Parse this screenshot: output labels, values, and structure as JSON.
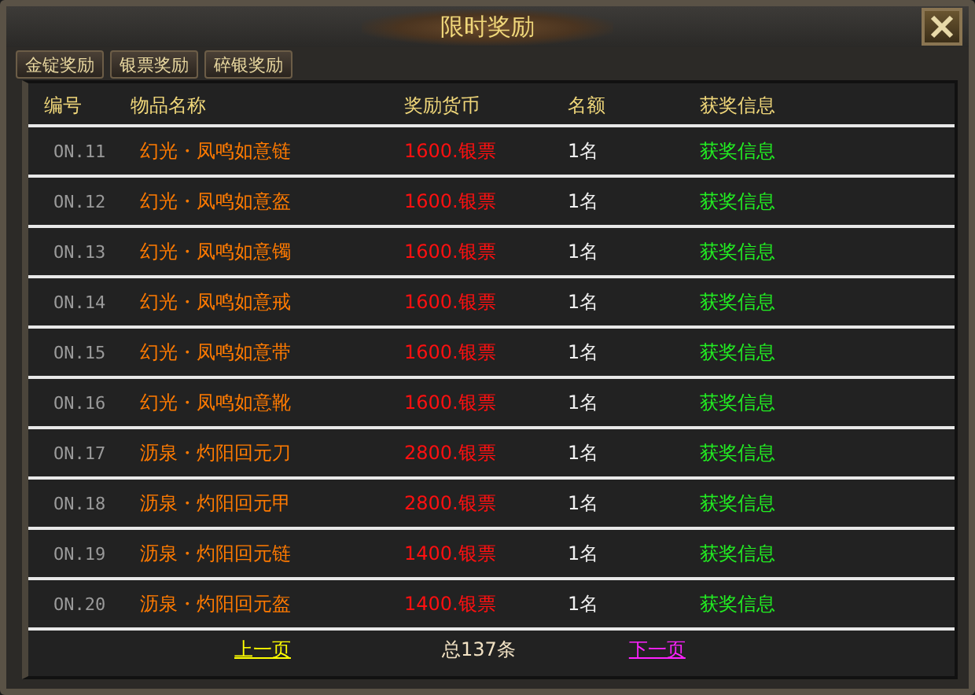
{
  "window": {
    "title": "限时奖励"
  },
  "tabs": [
    {
      "label": "金锭奖励"
    },
    {
      "label": "银票奖励"
    },
    {
      "label": "碎银奖励"
    }
  ],
  "table": {
    "columns": [
      "编号",
      "物品名称",
      "奖励货币",
      "名额",
      "获奖信息"
    ],
    "rows": [
      {
        "number": "ON.11",
        "item": "幻光・凤鸣如意链",
        "reward": "1600.银票",
        "quota": "1名",
        "info": "获奖信息"
      },
      {
        "number": "ON.12",
        "item": "幻光・凤鸣如意盔",
        "reward": "1600.银票",
        "quota": "1名",
        "info": "获奖信息"
      },
      {
        "number": "ON.13",
        "item": "幻光・凤鸣如意镯",
        "reward": "1600.银票",
        "quota": "1名",
        "info": "获奖信息"
      },
      {
        "number": "ON.14",
        "item": "幻光・凤鸣如意戒",
        "reward": "1600.银票",
        "quota": "1名",
        "info": "获奖信息"
      },
      {
        "number": "ON.15",
        "item": "幻光・凤鸣如意带",
        "reward": "1600.银票",
        "quota": "1名",
        "info": "获奖信息"
      },
      {
        "number": "ON.16",
        "item": "幻光・凤鸣如意靴",
        "reward": "1600.银票",
        "quota": "1名",
        "info": "获奖信息"
      },
      {
        "number": "ON.17",
        "item": "沥泉・灼阳回元刀",
        "reward": "2800.银票",
        "quota": "1名",
        "info": "获奖信息"
      },
      {
        "number": "ON.18",
        "item": "沥泉・灼阳回元甲",
        "reward": "2800.银票",
        "quota": "1名",
        "info": "获奖信息"
      },
      {
        "number": "ON.19",
        "item": "沥泉・灼阳回元链",
        "reward": "1400.银票",
        "quota": "1名",
        "info": "获奖信息"
      },
      {
        "number": "ON.20",
        "item": "沥泉・灼阳回元盔",
        "reward": "1400.银票",
        "quota": "1名",
        "info": "获奖信息"
      }
    ]
  },
  "pagination": {
    "previous": "上一页",
    "total": "总137条",
    "next": "下一页"
  }
}
